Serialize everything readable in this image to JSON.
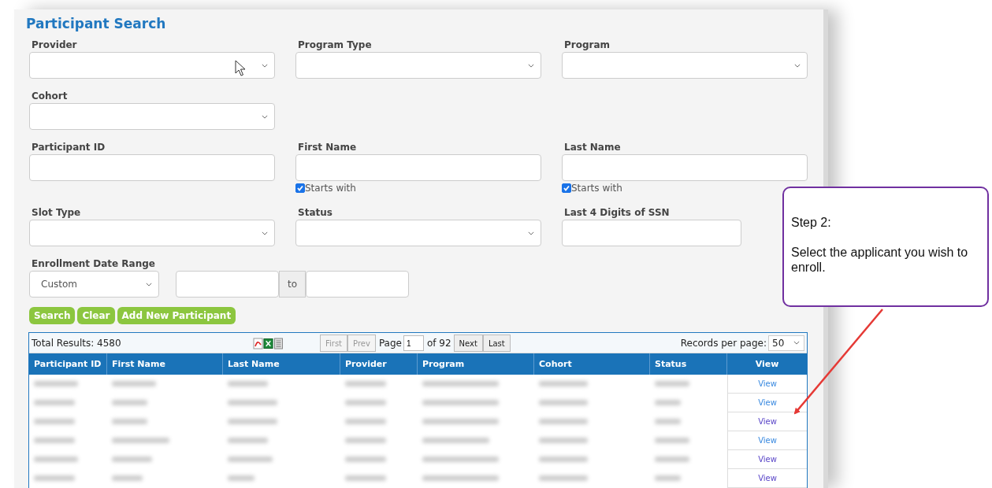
{
  "page": {
    "title": "Participant Search"
  },
  "filter_rows": [
    [
      {
        "kind": "select",
        "label": "Provider"
      },
      {
        "kind": "select",
        "label": "Program Type"
      },
      {
        "kind": "select",
        "label": "Program"
      }
    ],
    [
      {
        "kind": "select",
        "label": "Cohort"
      }
    ],
    [
      {
        "kind": "text",
        "label": "Participant ID"
      },
      {
        "kind": "text",
        "label": "First Name",
        "checkbox": {
          "label": "Starts with",
          "checked": true
        }
      },
      {
        "kind": "text",
        "label": "Last Name",
        "checkbox": {
          "label": "Starts with",
          "checked": true
        }
      }
    ],
    [
      {
        "kind": "select",
        "label": "Slot Type"
      },
      {
        "kind": "select",
        "label": "Status"
      },
      {
        "kind": "short",
        "label": "Last 4 Digits of SSN"
      }
    ],
    [
      {
        "kind": "daterange",
        "label": "Enrollment Date Range",
        "value": "Custom",
        "separator": "to"
      }
    ]
  ],
  "buttons": [
    "Search",
    "Clear",
    "Add New Participant"
  ],
  "grid": {
    "total": "Total Results: 4580",
    "pager": {
      "first": "First",
      "prev": "Prev",
      "page_label": "Page",
      "page": "1",
      "of": "of 92",
      "next": "Next",
      "last": "Last"
    },
    "records_label": "Records per page:",
    "records_value": "50",
    "columns": [
      "Participant ID",
      "First Name",
      "Last Name",
      "Provider",
      "Program",
      "Cohort",
      "Status",
      "View"
    ],
    "rows": [
      {
        "view": "View",
        "visited": false
      },
      {
        "view": "View",
        "visited": false
      },
      {
        "view": "View",
        "visited": true
      },
      {
        "view": "View",
        "visited": false
      },
      {
        "view": "View",
        "visited": true
      },
      {
        "view": "View",
        "visited": true
      }
    ]
  },
  "callout": {
    "title": "Step 2:",
    "text": "Select the applicant you wish to enroll."
  }
}
